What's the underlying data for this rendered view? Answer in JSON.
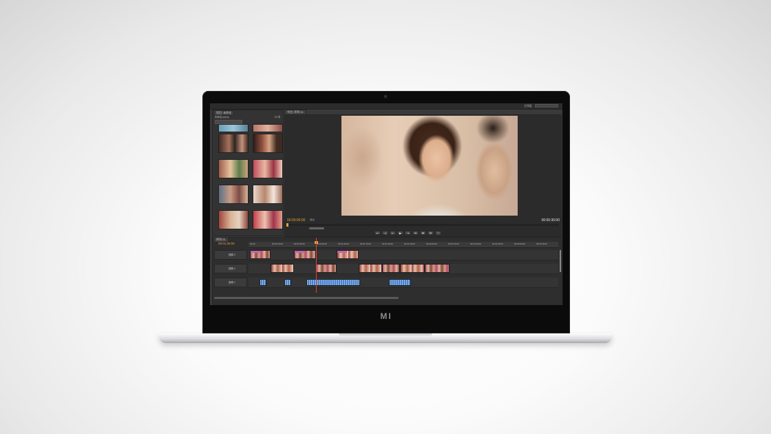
{
  "device": {
    "logo": "MI"
  },
  "app": {
    "workspace_label": "工作区",
    "workspace_value": "",
    "project_panel": {
      "tab": "项目: 未命名",
      "path": "未命名.prproj",
      "count": "24 项"
    },
    "program_monitor": {
      "tab": "节目: 序列 01",
      "timecode_current": "00:00:00:00",
      "fit_label": "适合",
      "timecode_duration": "00:00:30:00",
      "transport": [
        "⇤",
        "◁",
        "▷",
        "▶",
        "⇥",
        "⟲",
        "⊞",
        "⊟",
        "⬚"
      ]
    },
    "timeline": {
      "tab": "序列 01",
      "timecode": "00:01:30:06",
      "ruler_ticks": [
        "00:00",
        "00:00:15:00",
        "00:00:30:00",
        "00:00:45:00",
        "00:01:00:00",
        "00:01:15:00",
        "00:01:30:00",
        "00:01:45:00",
        "00:02:00:00",
        "00:02:15:00",
        "00:02:30:00",
        "00:02:45:00",
        "00:03:00:00",
        "00:03:15:00"
      ],
      "tracks": [
        {
          "id": "V2",
          "label": "视频 2"
        },
        {
          "id": "V1",
          "label": "视频 1"
        },
        {
          "id": "A1",
          "label": "音频 1"
        }
      ]
    }
  }
}
